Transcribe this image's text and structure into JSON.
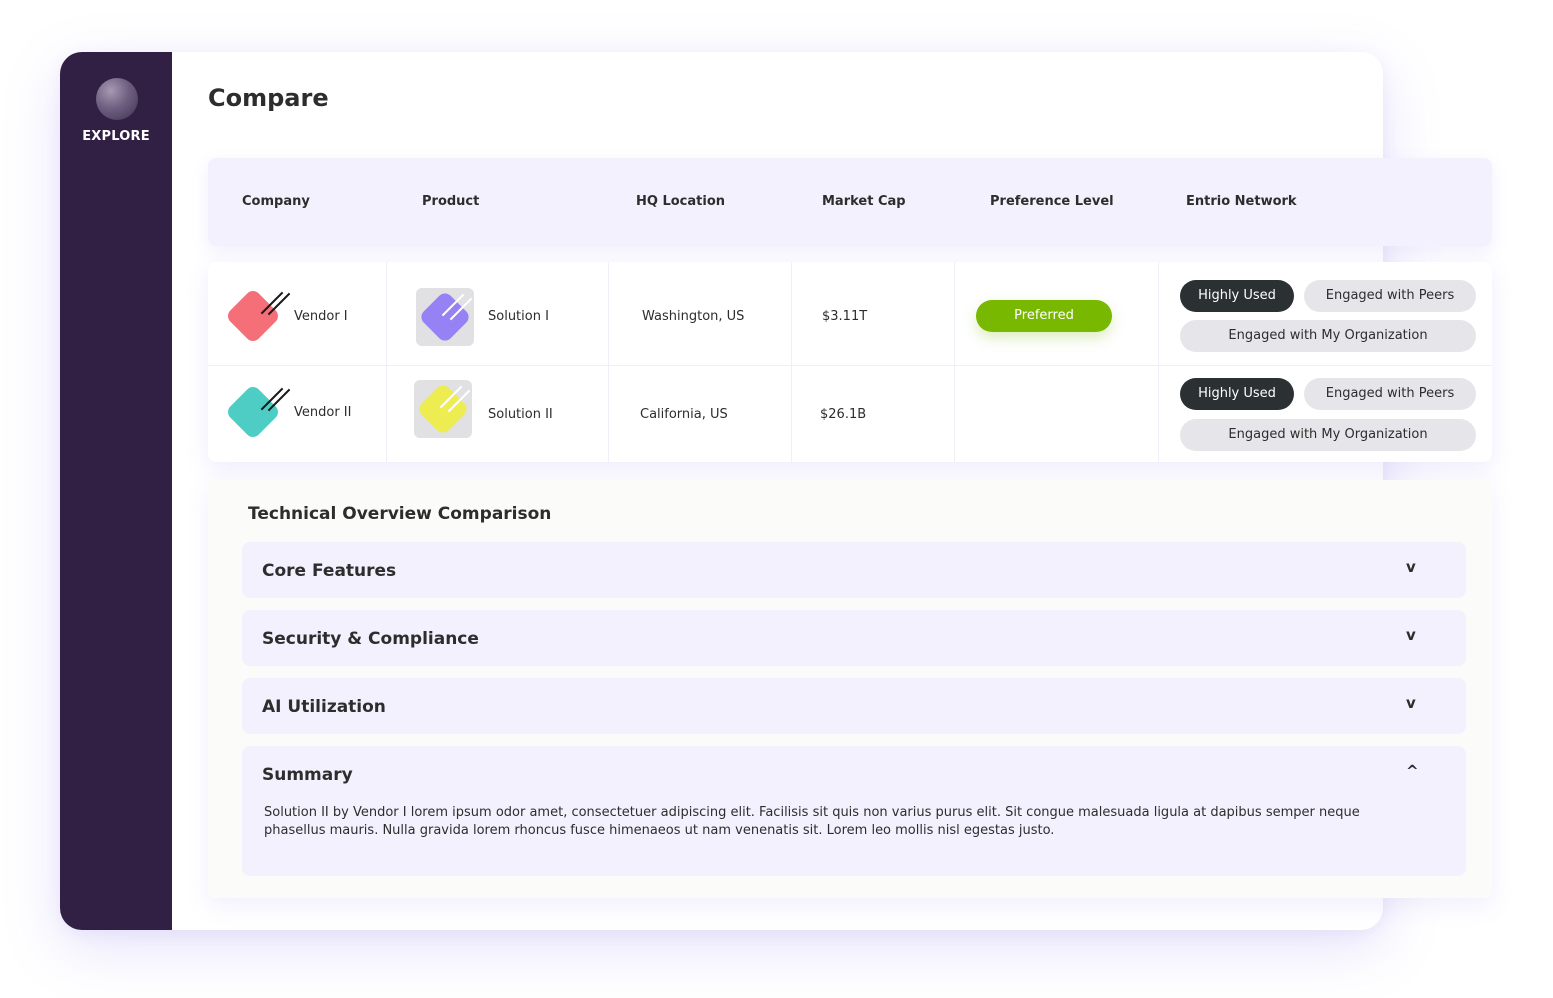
{
  "sidebar": {
    "label": "EXPLORE"
  },
  "page": {
    "title": "Compare"
  },
  "table": {
    "headers": [
      "Company",
      "Product",
      "HQ Location",
      "Market Cap",
      "Preference Level",
      "Entrio Network"
    ],
    "rows": [
      {
        "company": "Vendor I",
        "company_logo_color": "#f46f78",
        "product": "Solution I",
        "product_logo_color": "#9782f5",
        "hq": "Washington, US",
        "market_cap": "$3.11T",
        "preference": "Preferred",
        "network": [
          "Highly Used",
          "Engaged with Peers",
          "Engaged with My Organization"
        ]
      },
      {
        "company": "Vendor II",
        "company_logo_color": "#4ecdc4",
        "product": "Solution II",
        "product_logo_color": "#eded52",
        "hq": "California, US",
        "market_cap": "$26.1B",
        "preference": "",
        "network": [
          "Highly Used",
          "Engaged with Peers",
          "Engaged with My Organization"
        ]
      }
    ]
  },
  "tech": {
    "title": "Technical Overview Comparison",
    "sections": [
      {
        "label": "Core Features",
        "chevron": "v"
      },
      {
        "label": "Security & Compliance",
        "chevron": "v"
      },
      {
        "label": "AI Utilization",
        "chevron": "v"
      },
      {
        "label": "Summary",
        "chevron": "^",
        "body": "Solution II by Vendor I lorem ipsum odor amet, consectetuer adipiscing elit. Facilisis sit quis non varius purus elit. Sit congue malesuada ligula at dapibus semper neque phasellus mauris. Nulla gravida lorem rhoncus fusce himenaeos ut nam venenatis sit. Lorem leo mollis nisl egestas justo."
      }
    ]
  },
  "colors": {
    "sidebar": "#311f44",
    "accent_lavender": "#f3f1fd",
    "preferred_green": "#79b800",
    "chip_dark": "#2b3032",
    "chip_light": "#e6e5ea"
  }
}
